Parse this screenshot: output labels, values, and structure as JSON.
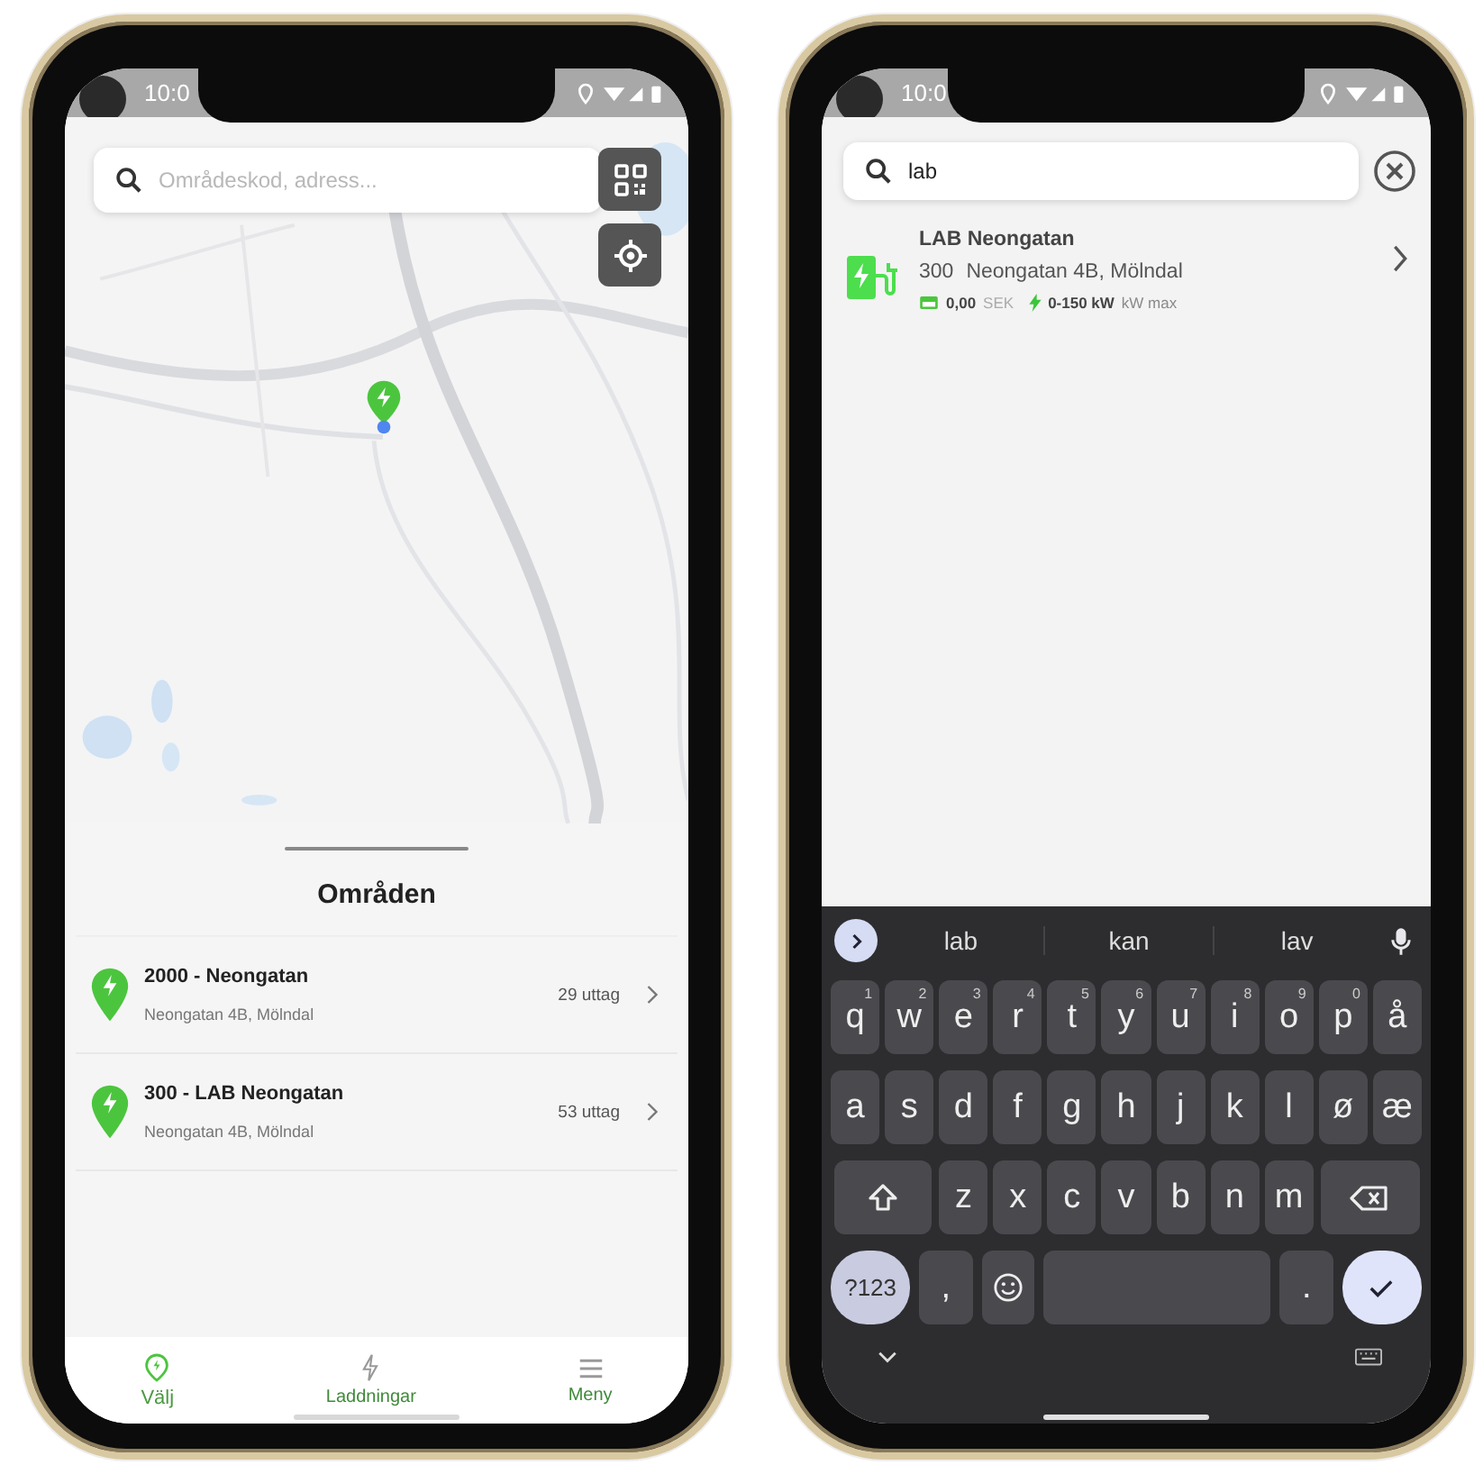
{
  "map_screen": {
    "status_bar": {
      "time": "10:0"
    },
    "search": {
      "placeholder": "Områdeskod, adress..."
    },
    "sheet": {
      "title": "Områden",
      "areas": [
        {
          "name": "2000 - Neongatan",
          "address": "Neongatan 4B, Mölndal",
          "outlets": "29 uttag"
        },
        {
          "name": "300 - LAB Neongatan",
          "address": "Neongatan 4B, Mölndal",
          "outlets": "53 uttag"
        }
      ]
    },
    "nav": [
      {
        "kind": "pin",
        "label": "Välj",
        "selected": true
      },
      {
        "kind": "bolt",
        "label": "Laddningar",
        "selected": false
      },
      {
        "kind": "menu",
        "label": "Meny",
        "selected": false
      }
    ]
  },
  "search_screen": {
    "status_bar": {
      "time": "10:0"
    },
    "search": {
      "value": "lab"
    },
    "results": [
      {
        "name": "LAB Neongatan",
        "code": "300",
        "address": "Neongatan 4B, Mölndal",
        "price": "0,00",
        "currency": "SEK",
        "power": "0-150 kW",
        "power_unit": "kW max"
      }
    ],
    "keyboard": {
      "suggestions": [
        "lab",
        "kan",
        "lav"
      ],
      "rows": [
        [
          {
            "kind": "letter",
            "label": "q",
            "hint": "1"
          },
          {
            "kind": "letter",
            "label": "w",
            "hint": "2"
          },
          {
            "kind": "letter",
            "label": "e",
            "hint": "3"
          },
          {
            "kind": "letter",
            "label": "r",
            "hint": "4"
          },
          {
            "kind": "letter",
            "label": "t",
            "hint": "5"
          },
          {
            "kind": "letter",
            "label": "y",
            "hint": "6"
          },
          {
            "kind": "letter",
            "label": "u",
            "hint": "7"
          },
          {
            "kind": "letter",
            "label": "i",
            "hint": "8"
          },
          {
            "kind": "letter",
            "label": "o",
            "hint": "9"
          },
          {
            "kind": "letter",
            "label": "p",
            "hint": "0"
          },
          {
            "kind": "letter",
            "label": "å"
          }
        ],
        [
          {
            "kind": "letter",
            "label": "a"
          },
          {
            "kind": "letter",
            "label": "s"
          },
          {
            "kind": "letter",
            "label": "d"
          },
          {
            "kind": "letter",
            "label": "f"
          },
          {
            "kind": "letter",
            "label": "g"
          },
          {
            "kind": "letter",
            "label": "h"
          },
          {
            "kind": "letter",
            "label": "j"
          },
          {
            "kind": "letter",
            "label": "k"
          },
          {
            "kind": "letter",
            "label": "l"
          },
          {
            "kind": "letter",
            "label": "ø"
          },
          {
            "kind": "letter",
            "label": "æ"
          }
        ]
      ],
      "third_row": [
        {
          "kind": "shift"
        },
        {
          "kind": "letter",
          "label": "z"
        },
        {
          "kind": "letter",
          "label": "x"
        },
        {
          "kind": "letter",
          "label": "c"
        },
        {
          "kind": "letter",
          "label": "v"
        },
        {
          "kind": "letter",
          "label": "b"
        },
        {
          "kind": "letter",
          "label": "n"
        },
        {
          "kind": "letter",
          "label": "m"
        },
        {
          "kind": "backspace"
        }
      ],
      "bottom_row": [
        {
          "kind": "mode",
          "label": "?123"
        },
        {
          "kind": "letter",
          "label": ","
        },
        {
          "kind": "emoji"
        },
        {
          "kind": "space"
        },
        {
          "kind": "letter",
          "label": "."
        },
        {
          "kind": "enter"
        }
      ]
    }
  }
}
